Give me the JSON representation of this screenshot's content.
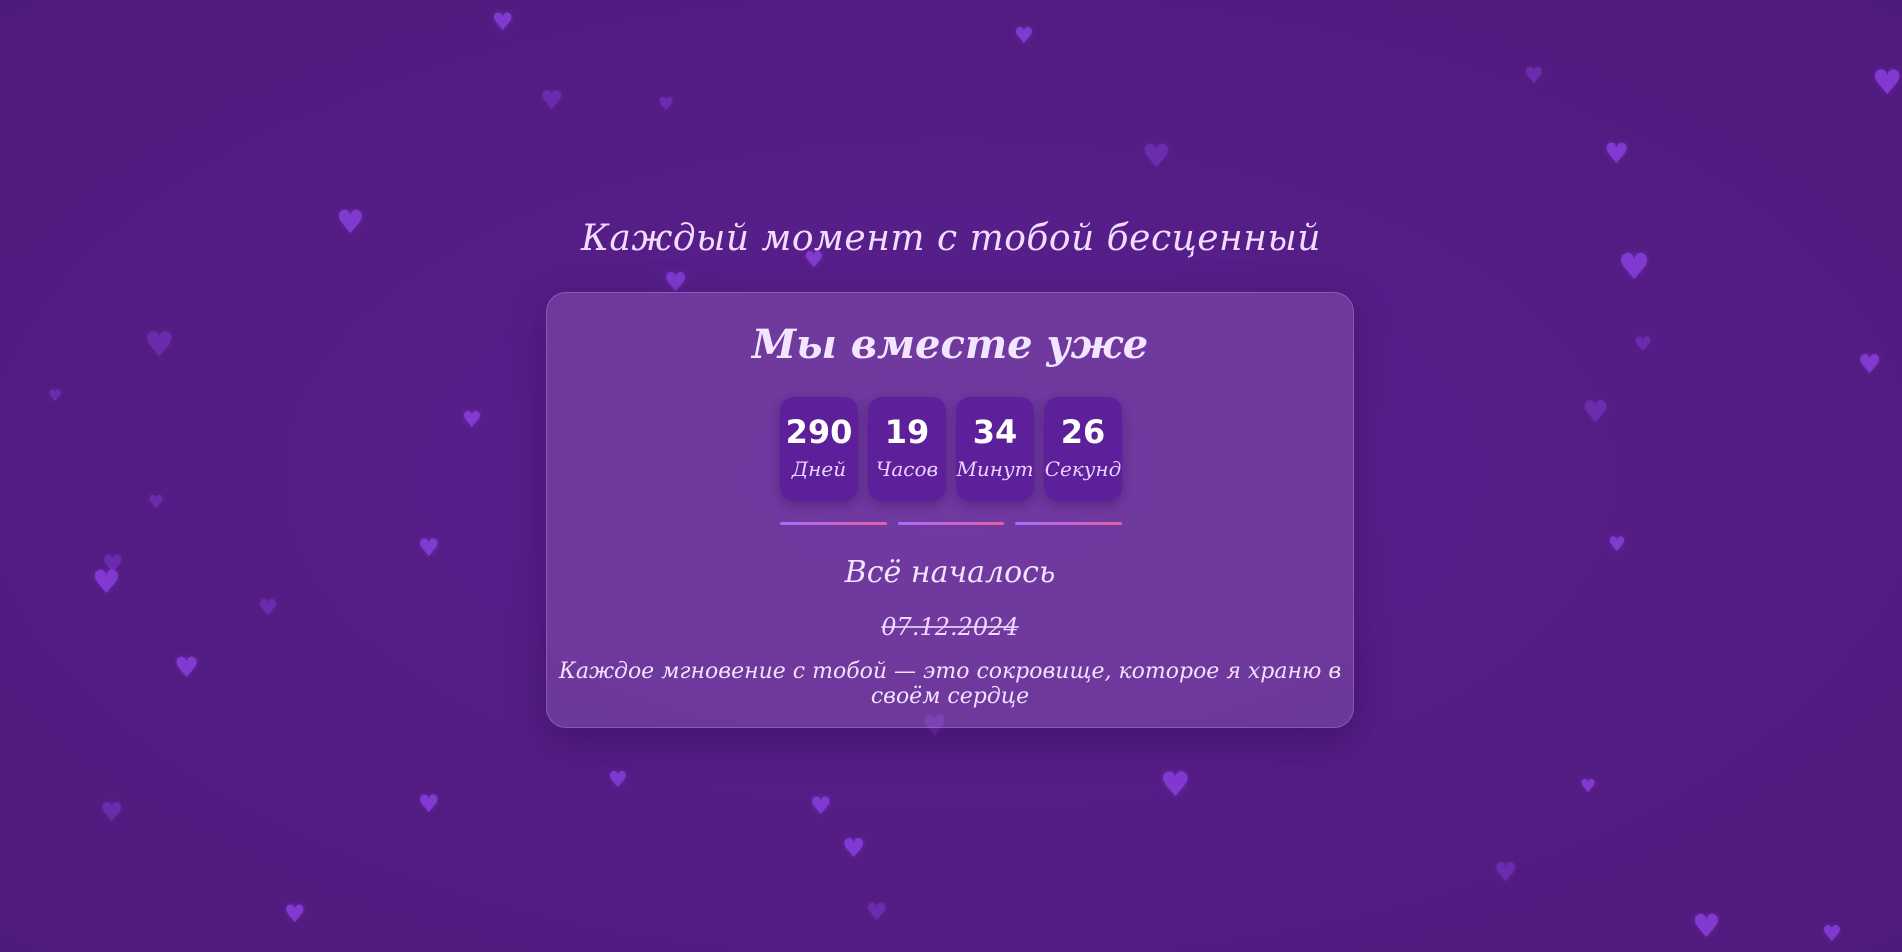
{
  "page": {
    "subtitle": "Каждый момент с тобой бесценный"
  },
  "card": {
    "title": "Мы вместе уже",
    "counters": [
      {
        "value": "290",
        "unit": "Дней"
      },
      {
        "value": "19",
        "unit": "Часов"
      },
      {
        "value": "34",
        "unit": "Минут"
      },
      {
        "value": "26",
        "unit": "Секунд"
      }
    ],
    "began_label": "Всё началось",
    "began_date": "07.12.2024",
    "quote": "Каждое мгновение с тобой — это сокровище, которое я храню в своём сердце"
  },
  "decor": {
    "heart_icon": "heart-icon",
    "background_color": "#541c84",
    "heart_color": "#8a3fe0",
    "accent_gradient": [
      "#a46bff",
      "#e65fa0"
    ]
  }
}
